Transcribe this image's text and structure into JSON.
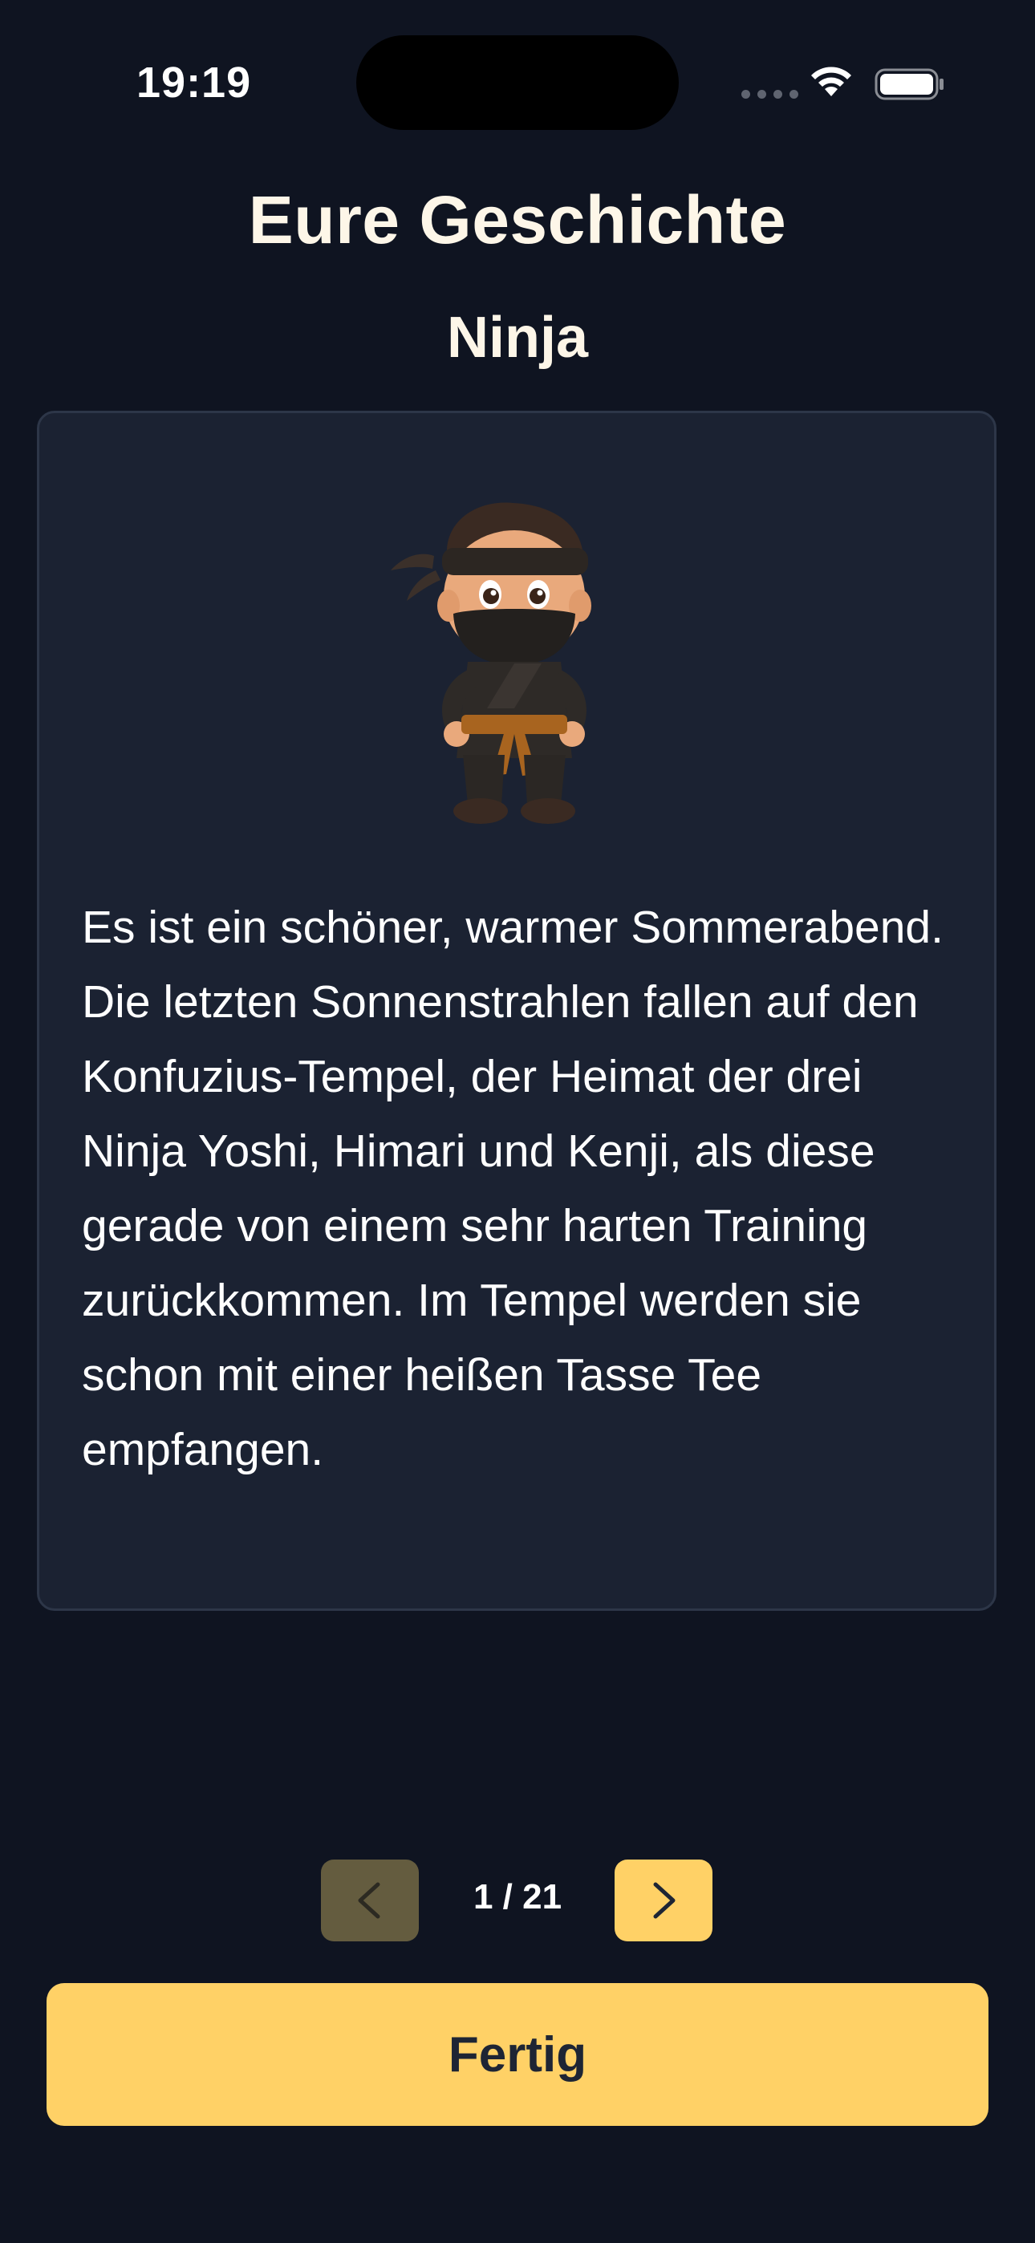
{
  "status_bar": {
    "time": "19:19"
  },
  "header": {
    "title": "Eure Geschichte",
    "subtitle": "Ninja"
  },
  "story": {
    "illustration": "ninja-character-illustration",
    "text": "Es ist ein schöner, warmer Sommerabend. Die letzten Sonnenstrahlen fallen auf den Konfuzius-Tempel, der Heimat der drei Ninja Yoshi, Himari und Kenji, als diese gerade von einem sehr harten Training zurückkommen. Im Tempel werden sie schon mit einer heißen Tasse Tee empfangen."
  },
  "pager": {
    "indicator": "1 / 21",
    "prev_icon": "chevron-left-icon",
    "next_icon": "chevron-right-icon",
    "prev_enabled": false
  },
  "actions": {
    "done_label": "Fertig"
  },
  "colors": {
    "background": "#0f1421",
    "card": "#1b2232",
    "accent": "#ffd166",
    "accent_disabled": "#645c3f",
    "text": "#fdf6e8"
  }
}
